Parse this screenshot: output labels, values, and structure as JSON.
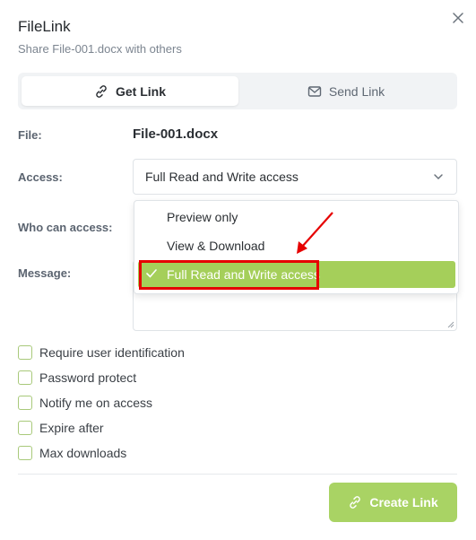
{
  "dialog": {
    "title": "FileLink",
    "subtitle": "Share File-001.docx with others"
  },
  "tabs": [
    {
      "label": "Get Link",
      "icon": "link-icon",
      "active": true
    },
    {
      "label": "Send Link",
      "icon": "mail-icon",
      "active": false
    }
  ],
  "form": {
    "file_label": "File:",
    "file_name": "File-001.docx",
    "access_label": "Access:",
    "access_value": "Full Read and Write access",
    "who_label": "Who can access:",
    "message_label": "Message:"
  },
  "dropdown": {
    "options": [
      "Preview only",
      "View & Download",
      "Full Read and Write access"
    ],
    "selected": "Full Read and Write access"
  },
  "options": [
    {
      "label": "Require user identification",
      "checked": false
    },
    {
      "label": "Password protect",
      "checked": false
    },
    {
      "label": "Notify me on access",
      "checked": false
    },
    {
      "label": "Expire after",
      "checked": false
    },
    {
      "label": "Max downloads",
      "checked": false
    }
  ],
  "footer": {
    "create_label": "Create Link"
  },
  "colors": {
    "accent": "#a9d364",
    "selected_option": "#a5cf5a",
    "annotation": "#e60000"
  }
}
